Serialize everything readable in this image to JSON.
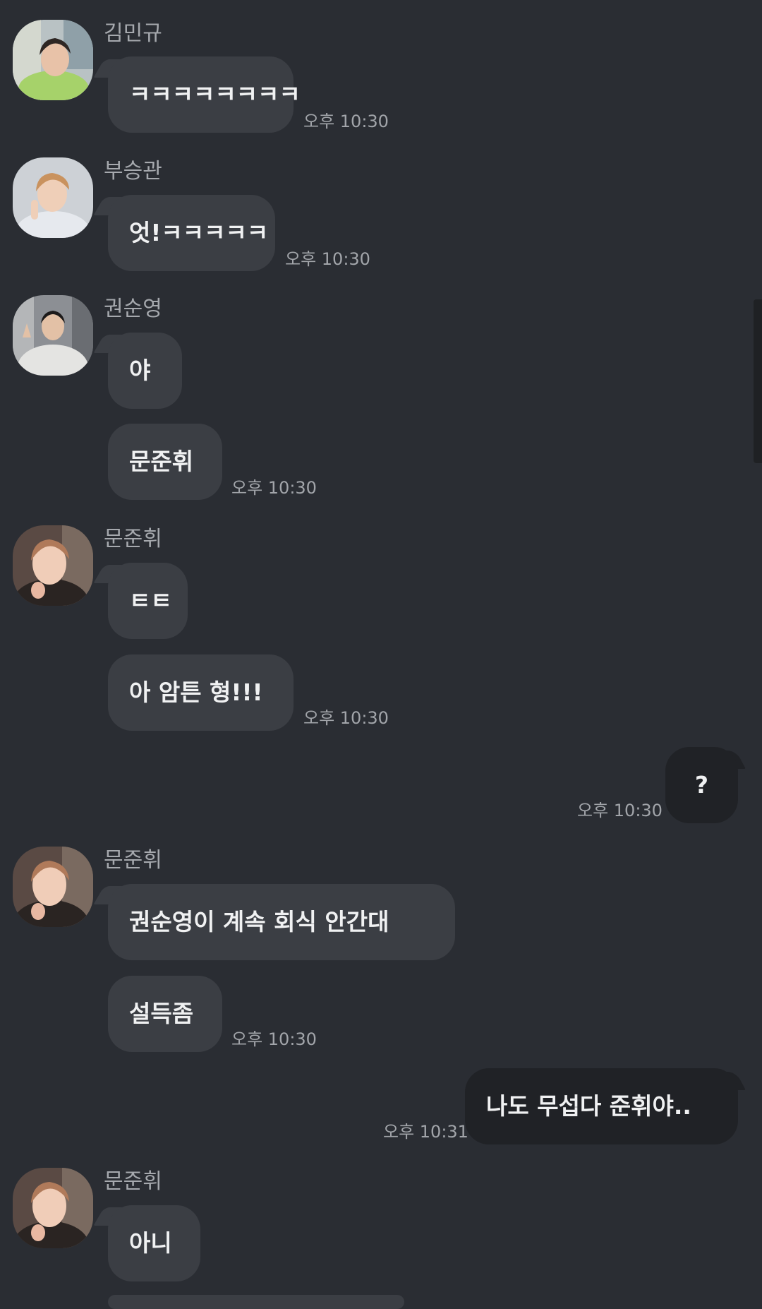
{
  "messages": [
    {
      "sender": "김민규",
      "avatar": "avatar-kim-mingyu",
      "text": "ㅋㅋㅋㅋㅋㅋㅋㅋ",
      "time": "오후 10:30"
    },
    {
      "sender": "부승관",
      "avatar": "avatar-boo-seungkwan",
      "text": "엇!ㅋㅋㅋㅋㅋ",
      "time": "오후 10:30"
    },
    {
      "sender": "권순영",
      "avatar": "avatar-kwon-soonyoung",
      "text": "야"
    },
    {
      "text": "문준휘",
      "time": "오후 10:30"
    },
    {
      "sender": "문준휘",
      "avatar": "avatar-moon-junhui",
      "text": "ㅌㅌ"
    },
    {
      "text": "아 암튼 형!!!",
      "time": "오후 10:30"
    },
    {
      "outgoing": true,
      "text": "?",
      "time": "오후 10:30"
    },
    {
      "sender": "문준휘",
      "avatar": "avatar-moon-junhui",
      "text": "권순영이 계속 회식 안간대"
    },
    {
      "text": "설득좀",
      "time": "오후 10:30"
    },
    {
      "outgoing": true,
      "text": "나도 무섭다 준휘야..",
      "time": "오후 10:31"
    },
    {
      "sender": "문준휘",
      "avatar": "avatar-moon-junhui",
      "text": "아니"
    }
  ],
  "colors": {
    "background": "#2a2d33",
    "incoming_bubble": "#3b3e44",
    "outgoing_bubble": "#202226",
    "text": "#f0f1f2",
    "meta_text": "#a6a9ae"
  }
}
